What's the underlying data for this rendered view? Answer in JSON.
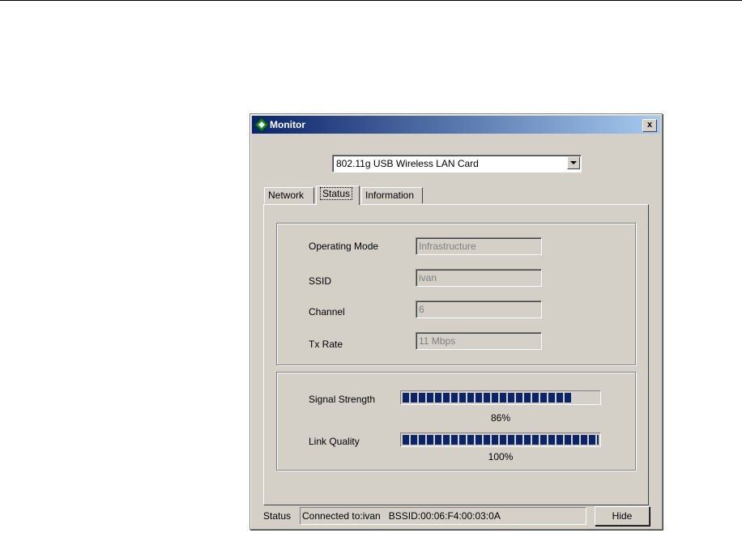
{
  "window": {
    "title": "Monitor",
    "close_label": "x"
  },
  "adapter": {
    "selected": "802.11g USB Wireless LAN Card"
  },
  "tabs": [
    {
      "label": "Network"
    },
    {
      "label": "Status"
    },
    {
      "label": "Information"
    }
  ],
  "status_tab": {
    "fields": [
      {
        "label": "Operating Mode",
        "value": "Infrastructure"
      },
      {
        "label": "SSID",
        "value": "ivan"
      },
      {
        "label": "Channel",
        "value": "6"
      },
      {
        "label": "Tx Rate",
        "value": "11 Mbps"
      }
    ],
    "signal_strength": {
      "label": "Signal Strength",
      "percent": 86,
      "text": "86%"
    },
    "link_quality": {
      "label": "Link Quality",
      "percent": 100,
      "text": "100%"
    }
  },
  "footer": {
    "status_label": "Status",
    "connected_text": "Connected to:ivan",
    "bssid_text": "BSSID:00:06:F4:00:03:0A",
    "hide_label": "Hide"
  },
  "colors": {
    "titlebar_start": "#0a246a",
    "titlebar_end": "#a6caf0",
    "progress": "#0a246a",
    "face": "#d4d0c8"
  },
  "icons": {
    "window_icon": "green-diamond-icon",
    "close": "close-icon",
    "dropdown": "chevron-down-icon"
  }
}
